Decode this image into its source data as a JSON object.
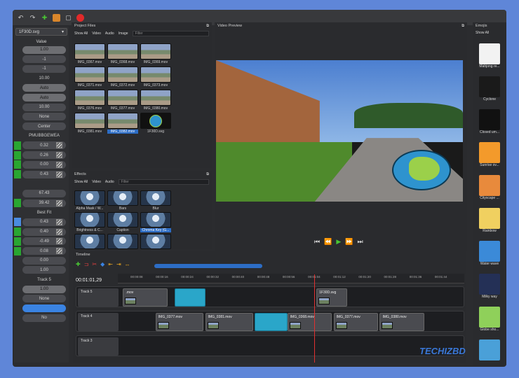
{
  "toolbar": {
    "icons": [
      "undo-icon",
      "redo-icon",
      "add-icon",
      "export-icon",
      "fullscreen-icon",
      "record-icon"
    ]
  },
  "properties": {
    "selected": "1F30D.svg",
    "header": "Value",
    "rows": [
      {
        "v": "1.00",
        "style": "bgl",
        "kf": "none"
      },
      {
        "v": "-1",
        "style": "bg",
        "kf": "none"
      },
      {
        "v": "-1",
        "style": "bg",
        "kf": "none"
      },
      {
        "v": "10.00",
        "style": "plain",
        "kf": "none"
      },
      {
        "v": "Auto",
        "style": "bgl",
        "kf": "none"
      },
      {
        "v": "Auto",
        "style": "bgl",
        "kf": "none"
      },
      {
        "v": "10.00",
        "style": "bg",
        "kf": "none"
      },
      {
        "v": "None",
        "style": "bg",
        "kf": "none"
      },
      {
        "v": "Center",
        "style": "bg",
        "kf": "none"
      },
      {
        "v": "PMUBBGEWEA",
        "style": "plain",
        "kf": "none"
      },
      {
        "v": "0.32",
        "style": "bg",
        "kf": "green",
        "chk": true
      },
      {
        "v": "0.26",
        "style": "bg",
        "kf": "green",
        "chk": true
      },
      {
        "v": "0.00",
        "style": "bg",
        "kf": "green",
        "chk": true
      },
      {
        "v": "0.43",
        "style": "bg",
        "kf": "green",
        "chk": true
      },
      {
        "v": "",
        "style": "plain",
        "kf": "none"
      },
      {
        "v": "67.43",
        "style": "bg",
        "kf": "none"
      },
      {
        "v": "39.42",
        "style": "bg",
        "kf": "green",
        "chk": true
      },
      {
        "v": "Best Fit",
        "style": "plain",
        "kf": "none"
      },
      {
        "v": "0.43",
        "style": "bg",
        "kf": "blue",
        "chk": true
      },
      {
        "v": "0.40",
        "style": "bg",
        "kf": "green",
        "chk": true
      },
      {
        "v": "-0.49",
        "style": "bg",
        "kf": "green",
        "chk": true
      },
      {
        "v": "0.08",
        "style": "bg",
        "kf": "green",
        "chk": true
      },
      {
        "v": "0.00",
        "style": "bg",
        "kf": "none"
      },
      {
        "v": "1.00",
        "style": "bg",
        "kf": "none"
      },
      {
        "v": "Track 5",
        "style": "plain",
        "kf": "none"
      },
      {
        "v": "1.00",
        "style": "bgl",
        "kf": "none"
      },
      {
        "v": "None",
        "style": "bg",
        "kf": "none"
      },
      {
        "v": "",
        "style": "blue",
        "kf": "none"
      },
      {
        "v": "No",
        "style": "bg",
        "kf": "none"
      }
    ]
  },
  "project_files": {
    "title": "Project Files",
    "filters": [
      "Show All",
      "Video",
      "Audio",
      "Image"
    ],
    "search_placeholder": "Filter",
    "items": [
      "IMG_0367.mov",
      "IMG_0368.mov",
      "IMG_0369.mov",
      "IMG_0371.mov",
      "IMG_0372.mov",
      "IMG_0373.mov",
      "IMG_0376.mov",
      "IMG_0377.mov",
      "IMG_0380.mov",
      "IMG_0381.mov",
      "IMG_0382.mov",
      "1F30D.svg"
    ],
    "selected_index": 10
  },
  "effects": {
    "title": "Effects",
    "filters": [
      "Show All",
      "Video",
      "Audio"
    ],
    "search_placeholder": "Filter",
    "items": [
      "Alpha Mask / W...",
      "Bars",
      "Blur",
      "Brightness & C...",
      "Caption",
      "Chroma Key (G...",
      "",
      "",
      ""
    ],
    "selected_index": 5
  },
  "video_preview": {
    "title": "Video Preview",
    "controls": [
      "⏮",
      "⏪",
      "▶",
      "⏩",
      "⏭"
    ]
  },
  "emojis": {
    "title": "Emojis",
    "filter": "Show All",
    "items": [
      "Mahjong re...",
      "Cyclone",
      "Closed um...",
      "Sunrise ov...",
      "Cityscape ...",
      "Rainbow",
      "Water wave",
      "Milky way",
      "Globe sho...",
      ""
    ],
    "colors": [
      "#f2f2f2",
      "#1a1a1a",
      "#111",
      "#f39a2b",
      "#e88a3c",
      "#f0d060",
      "#3b8ad8",
      "#243056",
      "#8fd05a",
      "#4aa0d8"
    ]
  },
  "timeline": {
    "title": "Timeline",
    "timecode": "00:01:01,29",
    "ticks": [
      "00:00:08",
      "00:00:16",
      "00:00:24",
      "00:00:32",
      "00:00:40",
      "00:00:48",
      "00:00:56",
      "00:01:04",
      "00:01:12",
      "00:01:20",
      "00:01:28",
      "00:01:36",
      "00:01:44"
    ],
    "tracks": [
      {
        "name": "Track 5",
        "clips": [
          {
            "label": ".mov",
            "kind": "clip",
            "s": 0.005,
            "w": 0.13
          },
          {
            "label": "",
            "kind": "tr",
            "s": 0.155,
            "w": 0.09
          },
          {
            "label": "1F30D.svg",
            "kind": "clip",
            "s": 0.57,
            "w": 0.09
          }
        ]
      },
      {
        "name": "Track 4",
        "clips": [
          {
            "label": "IMG_0377.mov",
            "kind": "clip",
            "s": 0.1,
            "w": 0.14
          },
          {
            "label": "IMG_0381.mov",
            "kind": "clip",
            "s": 0.245,
            "w": 0.14
          },
          {
            "label": "",
            "kind": "tr",
            "s": 0.39,
            "w": 0.095
          },
          {
            "label": "IMG_0368.mov",
            "kind": "clip",
            "s": 0.485,
            "w": 0.13
          },
          {
            "label": "IMG_0377.mov",
            "kind": "clip",
            "s": 0.62,
            "w": 0.13
          },
          {
            "label": "IMG_0380.mov",
            "kind": "clip",
            "s": 0.755,
            "w": 0.13
          }
        ]
      },
      {
        "name": "Track 3",
        "clips": []
      }
    ]
  },
  "watermark": "TECHIZBD"
}
